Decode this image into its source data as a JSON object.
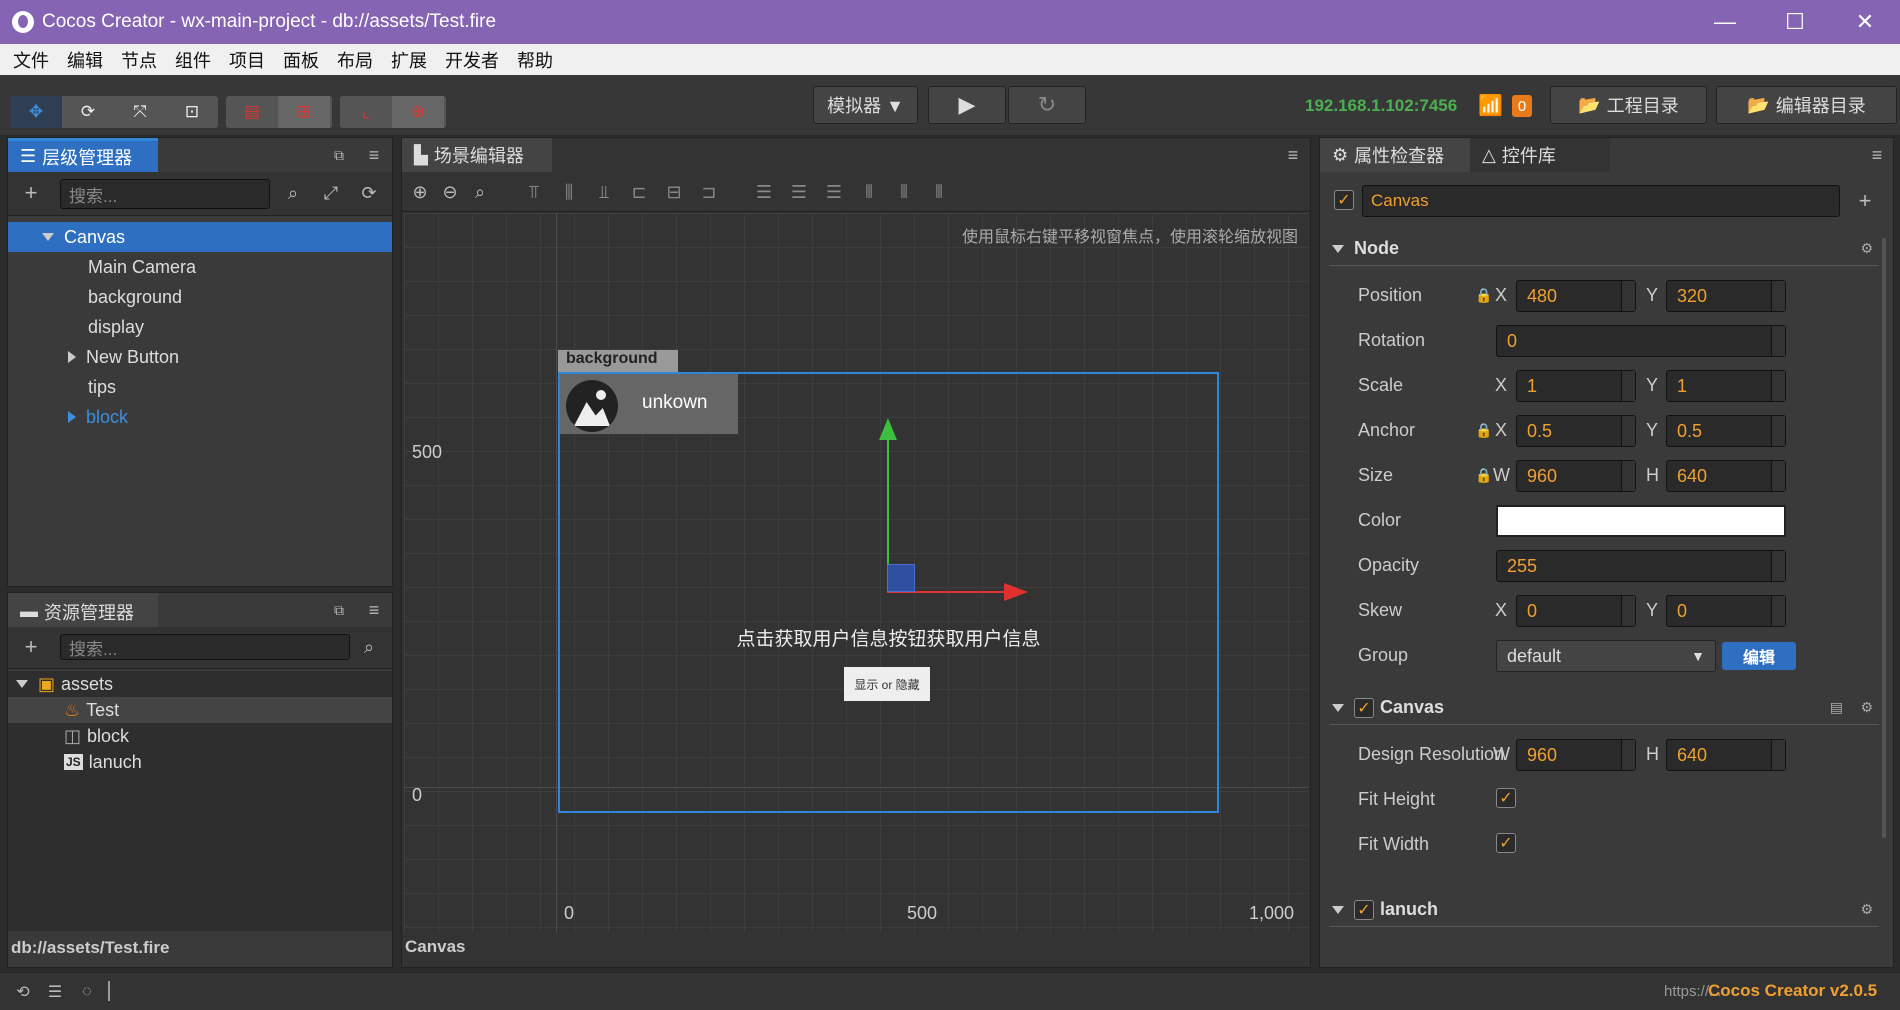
{
  "window": {
    "title": "Cocos Creator - wx-main-project - db://assets/Test.fire",
    "minimize": "—",
    "maximize": "☐",
    "close": "✕"
  },
  "menu": [
    "文件",
    "编辑",
    "节点",
    "组件",
    "项目",
    "面板",
    "布局",
    "扩展",
    "开发者",
    "帮助"
  ],
  "toolbar": {
    "simulator": "模拟器 ▼",
    "play": "▶",
    "refresh": "↻",
    "ip": "192.168.1.102:7456",
    "badge": "0",
    "project_dir": "工程目录",
    "editor_dir": "编辑器目录"
  },
  "hierarchy": {
    "tab": "层级管理器",
    "search_placeholder": "搜索...",
    "items": [
      {
        "label": "Canvas"
      },
      {
        "label": "Main Camera"
      },
      {
        "label": "background"
      },
      {
        "label": "display"
      },
      {
        "label": "New Button"
      },
      {
        "label": "tips"
      },
      {
        "label": "block"
      }
    ]
  },
  "assets": {
    "tab": "资源管理器",
    "search_placeholder": "搜索...",
    "items": [
      {
        "label": "assets"
      },
      {
        "label": "Test"
      },
      {
        "label": "block"
      },
      {
        "label": "lanuch"
      }
    ],
    "footer": "db://assets/Test.fire"
  },
  "scene": {
    "tab": "场景编辑器",
    "hint": "使用鼠标右键平移视窗焦点，使用滚轮缩放视图",
    "footer": "Canvas",
    "ruler_y": [
      "500",
      "0"
    ],
    "ruler_x": [
      "0",
      "500",
      "1,000"
    ],
    "bg_label": "background",
    "user_label": "unkown",
    "tip": "点击获取用户信息按钮获取用户信息",
    "button": "显示 or 隐藏"
  },
  "inspector": {
    "tab": "属性检查器",
    "tab2": "控件库",
    "node_name": "Canvas",
    "node_section": "Node",
    "position": {
      "label": "Position",
      "x": "480",
      "y": "320"
    },
    "rotation": {
      "label": "Rotation",
      "value": "0"
    },
    "scale": {
      "label": "Scale",
      "x": "1",
      "y": "1"
    },
    "anchor": {
      "label": "Anchor",
      "x": "0.5",
      "y": "0.5"
    },
    "size": {
      "label": "Size",
      "w": "960",
      "h": "640"
    },
    "color": {
      "label": "Color",
      "value": "#ffffff"
    },
    "opacity": {
      "label": "Opacity",
      "value": "255"
    },
    "skew": {
      "label": "Skew",
      "x": "0",
      "y": "0"
    },
    "group": {
      "label": "Group",
      "value": "default",
      "edit": "编辑"
    },
    "canvas_section": "Canvas",
    "design": {
      "label": "Design Resolution",
      "w": "960",
      "h": "640"
    },
    "fit_height": "Fit Height",
    "fit_width": "Fit Width",
    "lanuch_section": "lanuch",
    "axis_x": "X",
    "axis_y": "Y",
    "axis_w": "W",
    "axis_h": "H"
  },
  "status": {
    "url": "https://...",
    "version": "Cocos Creator v2.0.5"
  }
}
